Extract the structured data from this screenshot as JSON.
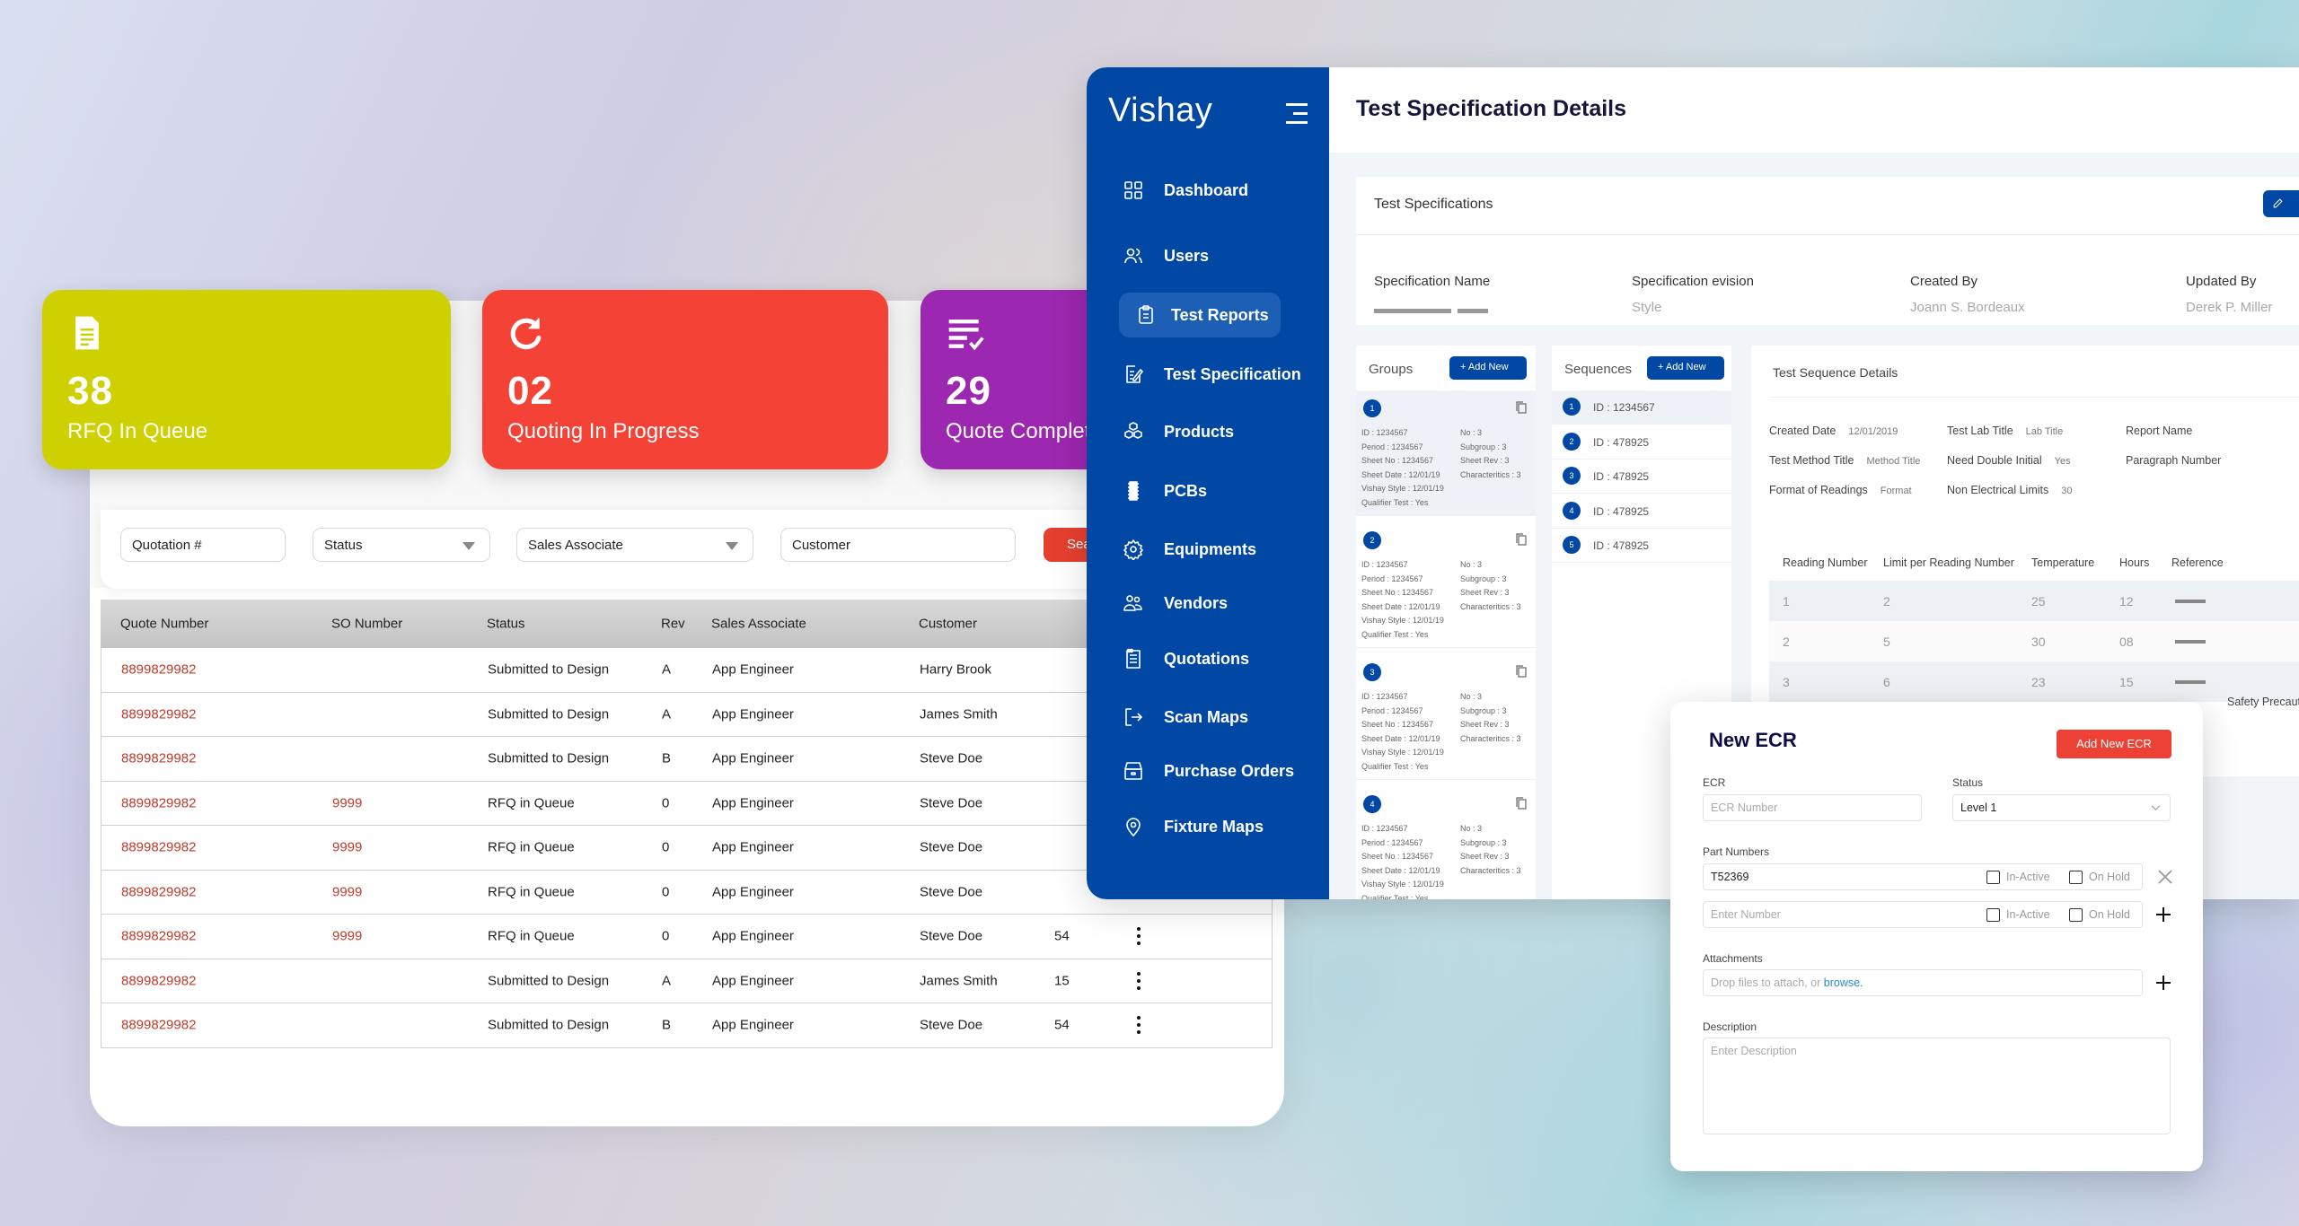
{
  "stat_cards": [
    {
      "icon": "document-icon",
      "count": "38",
      "label": "RFQ In Queue",
      "color": "#cfd000"
    },
    {
      "icon": "refresh-icon",
      "count": "02",
      "label": "Quoting In Progress",
      "color": "#f44336"
    },
    {
      "icon": "checklist-icon",
      "count": "29",
      "label": "Quote Completed",
      "color": "#9c27b0"
    }
  ],
  "filters": {
    "quotation_placeholder": "Quotation #",
    "status_placeholder": "Status",
    "sales_associate_placeholder": "Sales Associate",
    "customer_placeholder": "Customer",
    "search_label": "Search"
  },
  "quotes_table": {
    "columns": [
      "Quote Number",
      "SO Number",
      "Status",
      "Rev",
      "Sales Associate",
      "Customer"
    ],
    "rows": [
      {
        "quote": "8899829982",
        "so": "",
        "status": "Submitted to Design",
        "rev": "A",
        "associate": "App Engineer",
        "customer": "Harry Brook",
        "qty": ""
      },
      {
        "quote": "8899829982",
        "so": "",
        "status": "Submitted to Design",
        "rev": "A",
        "associate": "App Engineer",
        "customer": "James Smith",
        "qty": ""
      },
      {
        "quote": "8899829982",
        "so": "",
        "status": "Submitted to Design",
        "rev": "B",
        "associate": "App Engineer",
        "customer": "Steve Doe",
        "qty": ""
      },
      {
        "quote": "8899829982",
        "so": "9999",
        "status": "RFQ in Queue",
        "rev": "0",
        "associate": "App Engineer",
        "customer": "Steve Doe",
        "qty": ""
      },
      {
        "quote": "8899829982",
        "so": "9999",
        "status": "RFQ in Queue",
        "rev": "0",
        "associate": "App Engineer",
        "customer": "Steve Doe",
        "qty": ""
      },
      {
        "quote": "8899829982",
        "so": "9999",
        "status": "RFQ in Queue",
        "rev": "0",
        "associate": "App Engineer",
        "customer": "Steve Doe",
        "qty": ""
      },
      {
        "quote": "8899829982",
        "so": "9999",
        "status": "RFQ in Queue",
        "rev": "0",
        "associate": "App Engineer",
        "customer": "Steve Doe",
        "qty": "54"
      },
      {
        "quote": "8899829982",
        "so": "",
        "status": "Submitted to Design",
        "rev": "A",
        "associate": "App Engineer",
        "customer": "James Smith",
        "qty": "15"
      },
      {
        "quote": "8899829982",
        "so": "",
        "status": "Submitted to Design",
        "rev": "B",
        "associate": "App Engineer",
        "customer": "Steve Doe",
        "qty": "54"
      }
    ]
  },
  "app": {
    "brand": "Vishay",
    "brand_color": "#0148a4",
    "nav": [
      {
        "label": "Dashboard",
        "icon": "grid-icon"
      },
      {
        "label": "Users",
        "icon": "users-icon"
      },
      {
        "label": "Test Reports",
        "icon": "clipboard-icon",
        "active": true
      },
      {
        "label": "Test Specification",
        "icon": "edit-document-icon"
      },
      {
        "label": "Products",
        "icon": "cubes-icon"
      },
      {
        "label": "PCBs",
        "icon": "chip-icon"
      },
      {
        "label": "Equipments",
        "icon": "gear-icon"
      },
      {
        "label": "Vendors",
        "icon": "vendors-icon"
      },
      {
        "label": "Quotations",
        "icon": "quotation-list-icon"
      },
      {
        "label": "Scan Maps",
        "icon": "export-icon"
      },
      {
        "label": "Purchase Orders",
        "icon": "archive-box-icon"
      },
      {
        "label": "Fixture Maps",
        "icon": "location-pin-icon"
      }
    ],
    "page_title": "Test Specification Details",
    "specs": {
      "heading": "Test Specifications",
      "fields": [
        {
          "label": "Specification Name",
          "value": ""
        },
        {
          "label": "Specification evision",
          "value": "Style"
        },
        {
          "label": "Created By",
          "value": "Joann S. Bordeaux"
        },
        {
          "label": "Updated By",
          "value": "Derek P. Miller"
        }
      ]
    },
    "groups": {
      "heading": "Groups",
      "add_label": "+ Add New",
      "items": [
        {
          "n": "1",
          "id": "ID : 1234567",
          "period": "Period : 1234567",
          "sheet_no": "Sheet No : 1234567",
          "sheet_date": "Sheet Date : 12/01/19",
          "style": "Vishay Style : 12/01/19",
          "qualifier": "Qualifier Test : Yes",
          "no": "No : 3",
          "subgroup": "Subgroup : 3",
          "sheet_rev": "Sheet Rev : 3",
          "chars": "Characteritics : 3"
        },
        {
          "n": "2",
          "id": "ID : 1234567",
          "period": "Period : 1234567",
          "sheet_no": "Sheet No : 1234567",
          "sheet_date": "Sheet Date : 12/01/19",
          "style": "Vishay Style : 12/01/19",
          "qualifier": "Qualifier Test : Yes",
          "no": "No : 3",
          "subgroup": "Subgroup : 3",
          "sheet_rev": "Sheet Rev : 3",
          "chars": "Characteritics : 3"
        },
        {
          "n": "3",
          "id": "ID : 1234567",
          "period": "Period : 1234567",
          "sheet_no": "Sheet No : 1234567",
          "sheet_date": "Sheet Date : 12/01/19",
          "style": "Vishay Style : 12/01/19",
          "qualifier": "Qualifier Test : Yes",
          "no": "No : 3",
          "subgroup": "Subgroup : 3",
          "sheet_rev": "Sheet Rev : 3",
          "chars": "Characteritics : 3"
        },
        {
          "n": "4",
          "id": "ID : 1234567",
          "period": "Period : 1234567",
          "sheet_no": "Sheet No : 1234567",
          "sheet_date": "Sheet Date : 12/01/19",
          "style": "Vishay Style : 12/01/19",
          "qualifier": "Qualifier Test : Yes",
          "no": "No : 3",
          "subgroup": "Subgroup : 3",
          "sheet_rev": "Sheet Rev : 3",
          "chars": "Characteritics : 3"
        }
      ]
    },
    "sequences": {
      "heading": "Sequences",
      "add_label": "+ Add New",
      "items": [
        {
          "n": "1",
          "id": "ID : 1234567"
        },
        {
          "n": "2",
          "id": "ID : 478925"
        },
        {
          "n": "3",
          "id": "ID : 478925"
        },
        {
          "n": "4",
          "id": "ID : 478925"
        },
        {
          "n": "5",
          "id": "ID : 478925"
        }
      ]
    },
    "sequence_details": {
      "heading": "Test Sequence Details",
      "fields": [
        {
          "label": "Created Date",
          "value": "12/01/2019"
        },
        {
          "label": "Test Lab Title",
          "value": "Lab Title"
        },
        {
          "label": "Report Name",
          "value": ""
        },
        {
          "label": "Test Method Title",
          "value": "Method Title"
        },
        {
          "label": "Need Double Initial",
          "value": "Yes"
        },
        {
          "label": "Paragraph Number",
          "value": ""
        },
        {
          "label": "Format of Readings",
          "value": "Format"
        },
        {
          "label": "Non Electrical Limits",
          "value": "30"
        }
      ],
      "readings": {
        "columns": [
          "Reading Number",
          "Limit per Reading Number",
          "Temperature",
          "Hours",
          "Reference"
        ],
        "rows": [
          {
            "reading": "1",
            "limit": "2",
            "temp": "25",
            "hours": "12"
          },
          {
            "reading": "2",
            "limit": "5",
            "temp": "30",
            "hours": "08"
          },
          {
            "reading": "3",
            "limit": "6",
            "temp": "23",
            "hours": "15"
          }
        ]
      },
      "safety_label": "Safety Precautions"
    }
  },
  "ecr_modal": {
    "title": "New ECR",
    "add_button": "Add New ECR",
    "ecr_label": "ECR",
    "ecr_placeholder": "ECR Number",
    "status_label": "Status",
    "status_value": "Level 1",
    "part_numbers_label": "Part Numbers",
    "part_rows": [
      {
        "value": "T52369",
        "placeholder": "",
        "inactive_label": "In-Active",
        "onhold_label": "On Hold",
        "action": "remove"
      },
      {
        "value": "",
        "placeholder": "Enter Number",
        "inactive_label": "In-Active",
        "onhold_label": "On Hold",
        "action": "add"
      }
    ],
    "attachments_label": "Attachments",
    "attachments_text": "Drop files to attach, or ",
    "attachments_link": "browse.",
    "description_label": "Description",
    "description_placeholder": "Enter Description"
  }
}
